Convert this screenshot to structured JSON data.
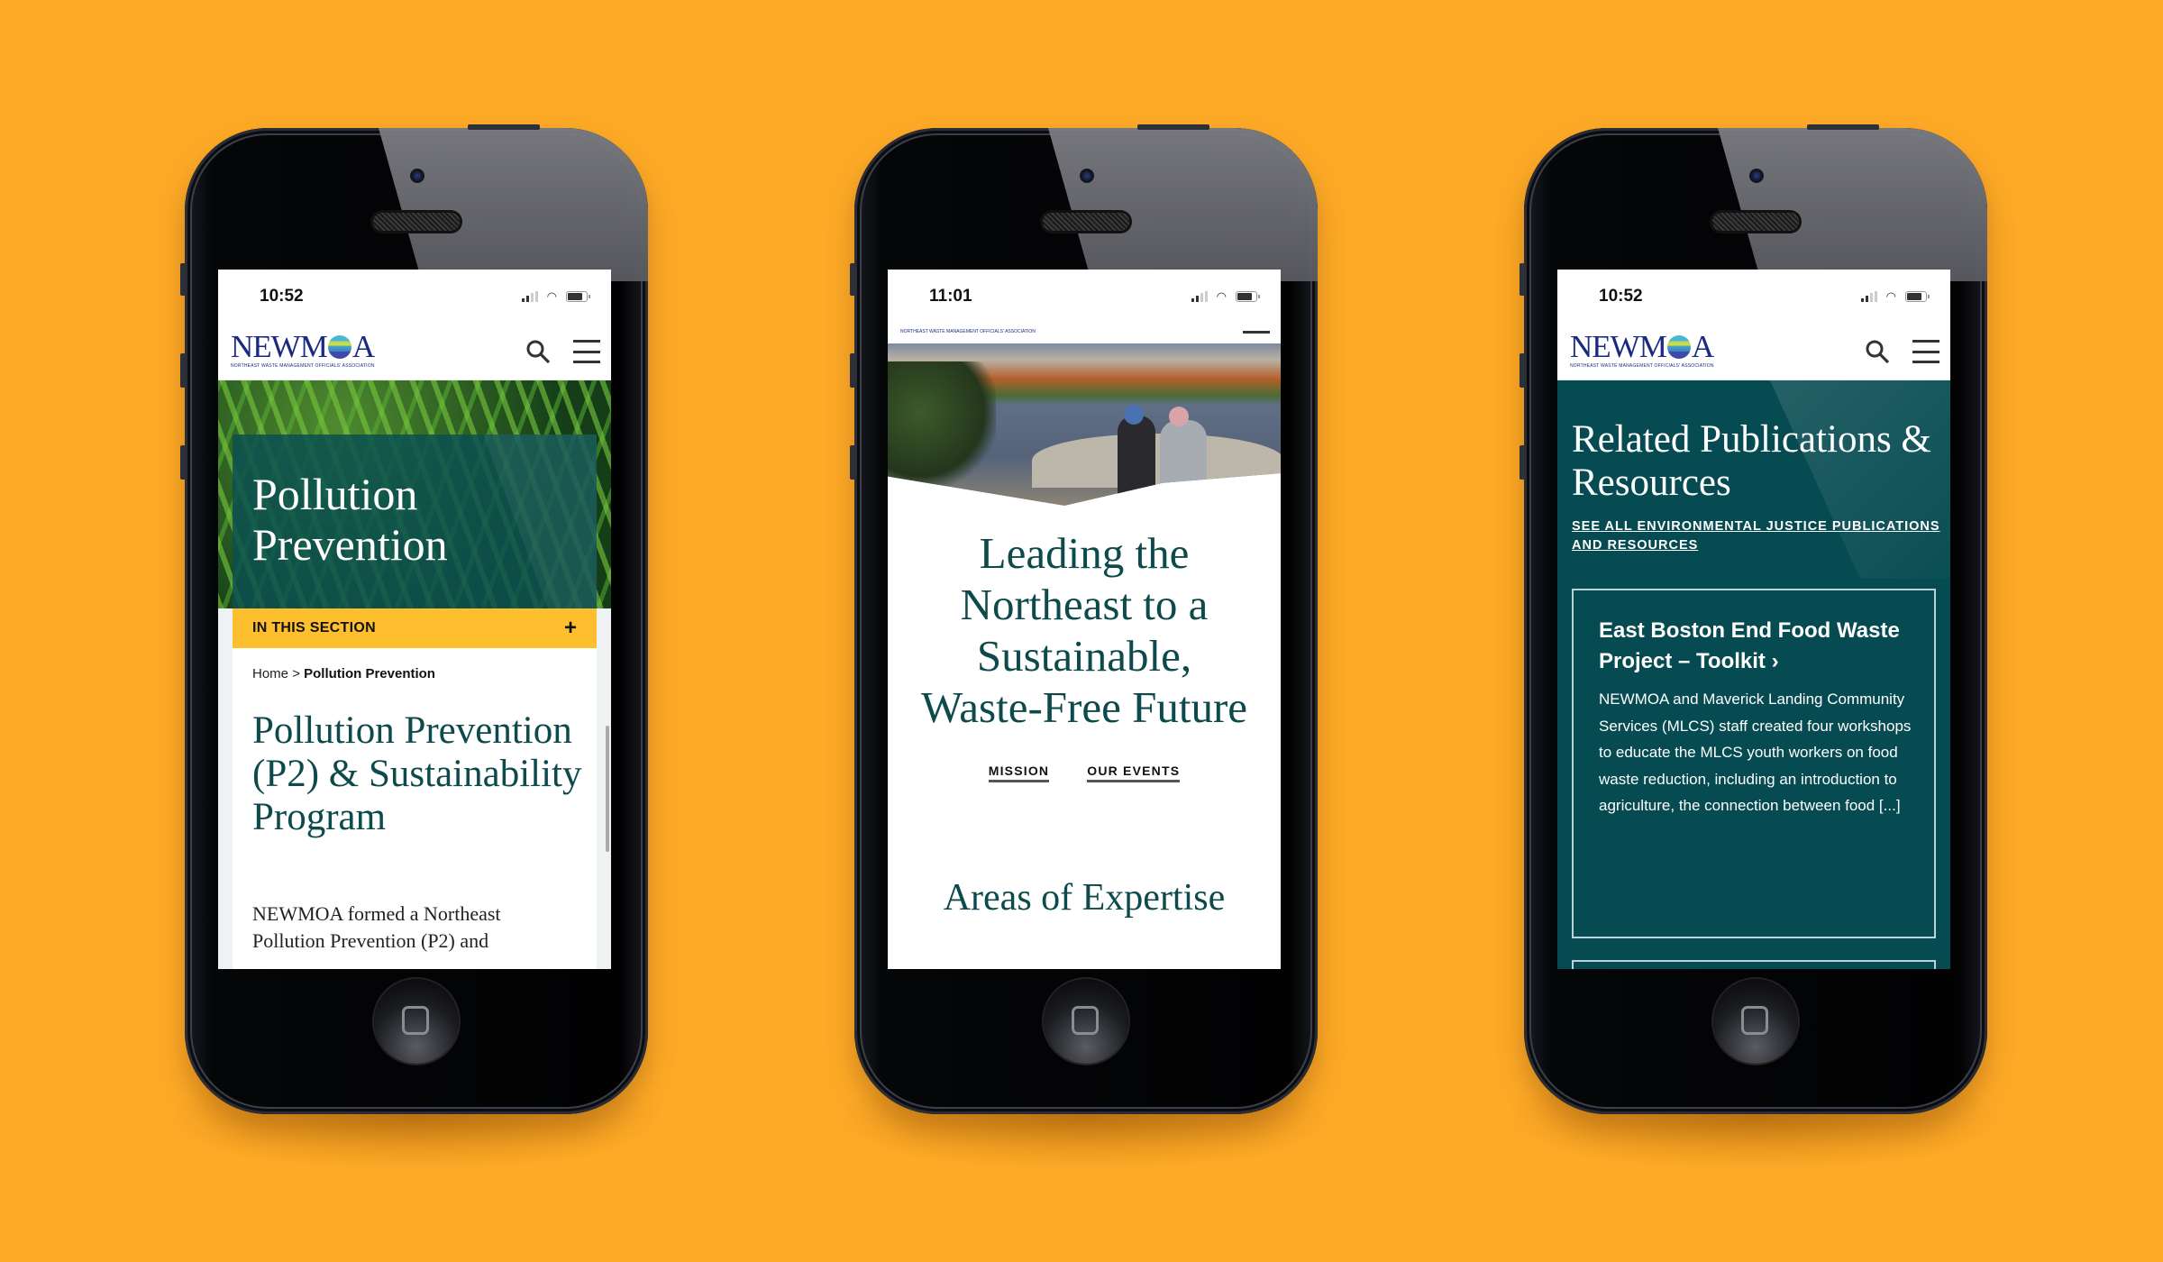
{
  "background_color": "#fdaa27",
  "brand": {
    "logo_text_prefix": "NEWM",
    "logo_text_suffix": "A",
    "logo_tagline": "NORTHEAST WASTE MANAGEMENT OFFICIALS' ASSOCIATION",
    "primary_color": "#0d4a4c",
    "accent_color": "#fdbf2d"
  },
  "phones": [
    {
      "status_time": "10:52",
      "nav": {
        "search_icon": "search-icon",
        "menu_icon": "hamburger-menu-icon"
      },
      "hero_title": "Pollution Prevention",
      "section_bar": {
        "label": "IN THIS SECTION",
        "toggle": "+"
      },
      "breadcrumb": {
        "home": "Home",
        "separator": ">",
        "current": "Pollution Prevention"
      },
      "page_title": "Pollution Prevention (P2) & Sustainability Program",
      "body_line1": "NEWMOA formed a Northeast",
      "body_line2": "Pollution Prevention (P2) and"
    },
    {
      "status_time": "11:01",
      "hero_title": "Leading the Northeast to a Sustainable, Waste-Free Future",
      "links": [
        "MISSION",
        "OUR EVENTS"
      ],
      "section_heading": "Areas of Expertise"
    },
    {
      "status_time": "10:52",
      "nav": {
        "search_icon": "search-icon",
        "menu_icon": "hamburger-menu-icon"
      },
      "section_title": "Related Publications & Resources",
      "see_all_link": "SEE ALL ENVIRONMENTAL JUSTICE PUBLICATIONS AND RESOURCES",
      "card": {
        "title": "East Boston End Food Waste Project – Toolkit ›",
        "body": "NEWMOA and Maverick Landing Community Services (MLCS) staff created four workshops to educate the MLCS youth workers on food waste reduction, including an introduction to agriculture, the connection between food [...]"
      }
    }
  ]
}
